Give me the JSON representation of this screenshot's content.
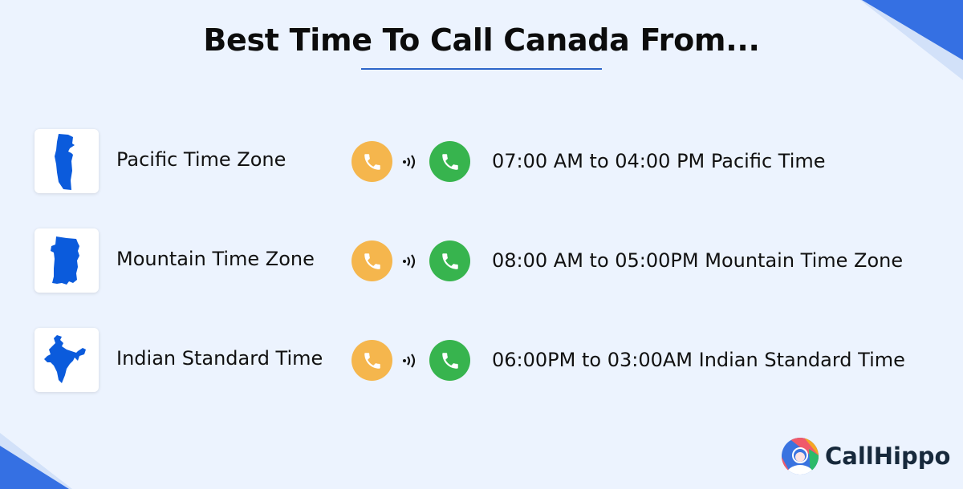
{
  "title": "Best Time To Call Canada From...",
  "rows": [
    {
      "zone": "Pacific Time Zone",
      "map_icon": "pacific-region-map-icon",
      "time_range": "07:00 AM to 04:00 PM Pacific Time"
    },
    {
      "zone": "Mountain Time Zone",
      "map_icon": "mountain-region-map-icon",
      "time_range": "08:00 AM to 05:00PM Mountain Time Zone"
    },
    {
      "zone": "Indian Standard Time",
      "map_icon": "india-map-icon",
      "time_range": "06:00PM to 03:00AM Indian Standard Time"
    }
  ],
  "icons": {
    "caller": "phone-outgoing-icon",
    "signal": "signal-waves-icon",
    "receiver": "phone-incoming-icon"
  },
  "colors": {
    "background": "#ecf3fe",
    "accent_blue": "#3570e3",
    "map_blue": "#0b5bdc",
    "caller_orange": "#f5b64d",
    "receiver_green": "#37b44e",
    "underline": "#2e66c9"
  },
  "brand": {
    "name": "CallHippo"
  }
}
